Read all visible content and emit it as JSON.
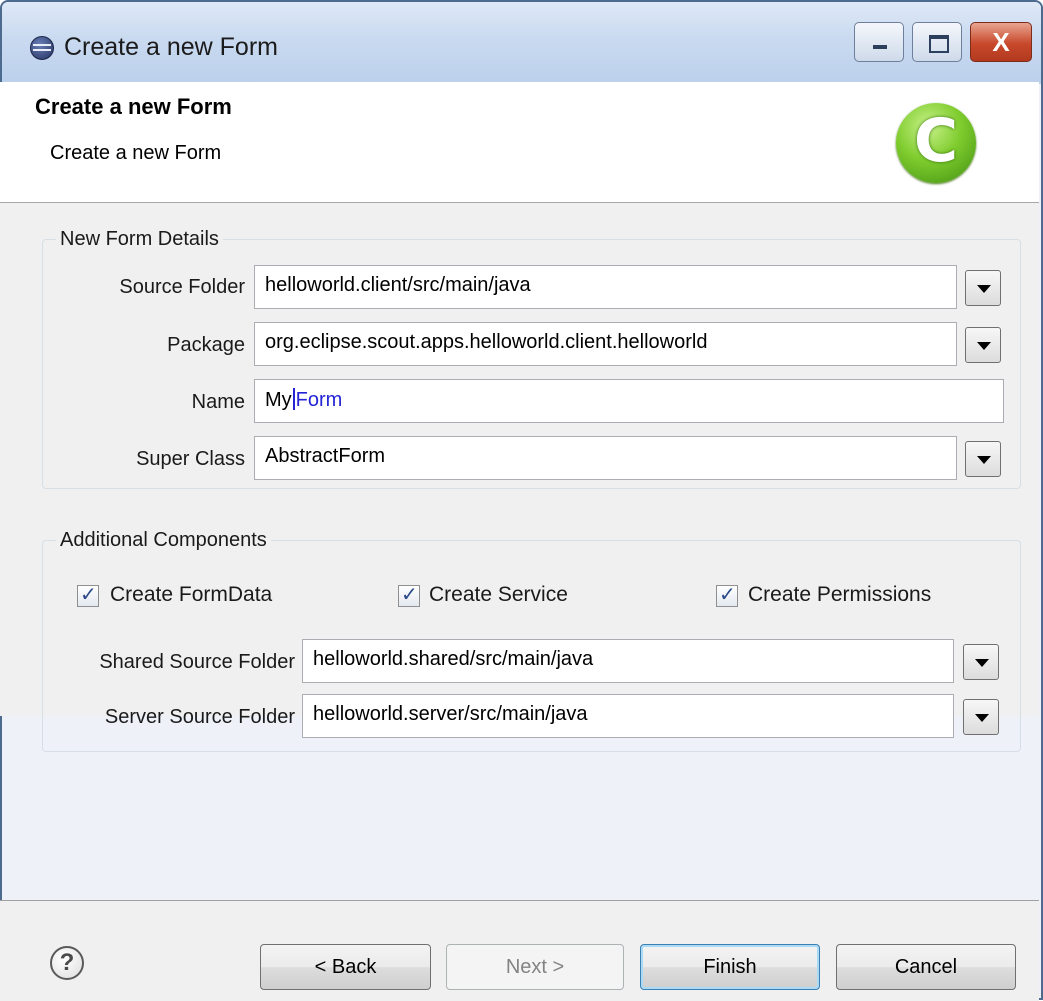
{
  "window": {
    "title": "Create a new Form",
    "controls": {
      "minimize": "minimize",
      "maximize": "maximize",
      "close": "X"
    }
  },
  "header": {
    "title": "Create a new Form",
    "subtitle": "Create a new Form",
    "logo_letter": "C"
  },
  "form_details": {
    "legend": "New Form Details",
    "source_folder": {
      "label": "Source Folder",
      "value": "helloworld.client/src/main/java"
    },
    "package": {
      "label": "Package",
      "value": "org.eclipse.scout.apps.helloworld.client.helloworld"
    },
    "name": {
      "label": "Name",
      "value_typed": "My",
      "value_selected": "Form"
    },
    "super_class": {
      "label": "Super Class",
      "value": "AbstractForm"
    }
  },
  "additional": {
    "legend": "Additional Components",
    "checkboxes": [
      {
        "label": "Create FormData",
        "checked": true
      },
      {
        "label": "Create Service",
        "checked": true
      },
      {
        "label": "Create Permissions",
        "checked": true
      }
    ],
    "shared_source_folder": {
      "label": "Shared Source Folder",
      "value": "helloworld.shared/src/main/java"
    },
    "server_source_folder": {
      "label": "Server Source Folder",
      "value": "helloworld.server/src/main/java"
    }
  },
  "buttons": {
    "help": "?",
    "back": "< Back",
    "next": "Next >",
    "finish": "Finish",
    "cancel": "Cancel"
  },
  "colors": {
    "selection_text": "#2424d6",
    "title_bar": "#c9daf0",
    "close_button": "#c8482b",
    "logo_green": "#7fcc2e"
  }
}
